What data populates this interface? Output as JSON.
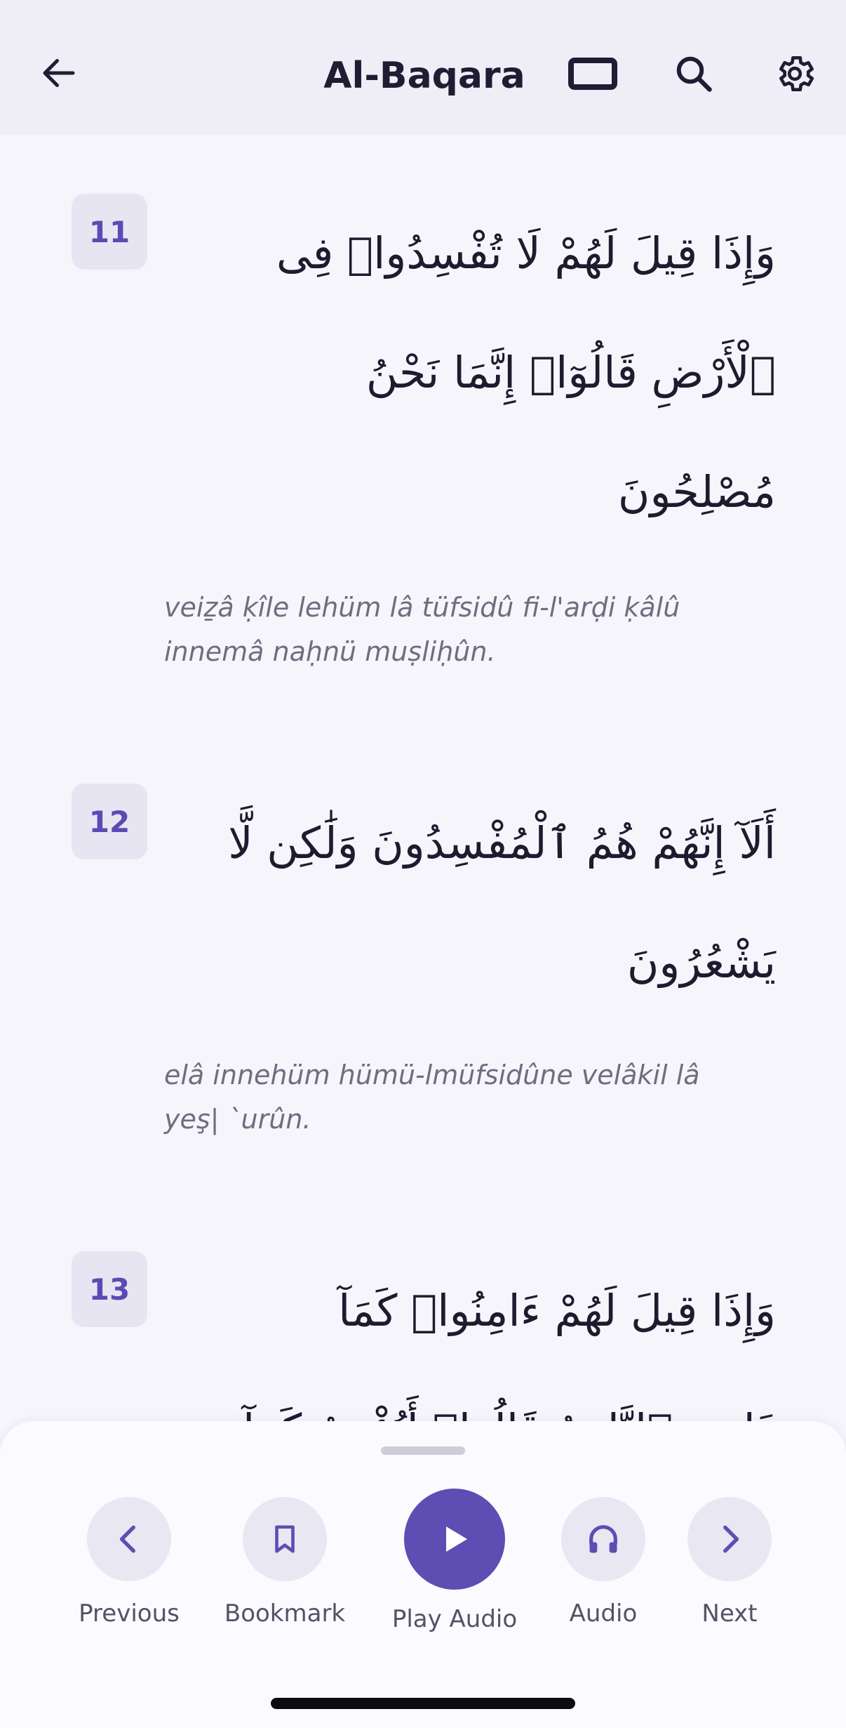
{
  "header": {
    "title": "Al-Baqara",
    "back_icon": "arrow-left-icon",
    "view_icon": "rectangle-view-icon",
    "search_icon": "search-icon",
    "settings_icon": "gear-icon"
  },
  "verses": [
    {
      "number": "11",
      "arabic_lines": [
        "وَإِذَا قِيلَ لَهُمْ لَا تُفْسِدُوا۟ فِى",
        "ٱلْأَرْضِ قَالُوٓا۟ إِنَّمَا نَحْنُ",
        "مُصْلِحُونَ"
      ],
      "transliteration_lines": [
        "veiẕâ ḳîle lehüm lâ tüfsidû fi-l'arḍi ḳâlû",
        "innemâ naḥnü muṣliḥûn."
      ]
    },
    {
      "number": "12",
      "arabic_lines": [
        "أَلَآ إِنَّهُمْ هُمُ ٱلْمُفْسِدُونَ وَلَٰكِن لَّا",
        "يَشْعُرُونَ"
      ],
      "transliteration_lines": [
        "elâ innehüm hümü-lmüfsidûne velâkil lâ",
        "yeş| `urûn."
      ]
    },
    {
      "number": "13",
      "arabic_lines": [
        "وَإِذَا قِيلَ لَهُمْ ءَامِنُوا۟ كَمَآ",
        "ءَامَنَ ٱلنَّاسُ قَالُوٓا۟ أَنُؤْمِنُ كَمَآ"
      ],
      "transliteration_lines": []
    }
  ],
  "player": {
    "previous_label": "Previous",
    "bookmark_label": "Bookmark",
    "play_label": "Play Audio",
    "audio_label": "Audio",
    "next_label": "Next",
    "icons": {
      "previous": "chevron-left-icon",
      "bookmark": "bookmark-icon",
      "play": "play-icon",
      "audio": "headphones-icon",
      "next": "chevron-right-icon"
    }
  },
  "colors": {
    "accent": "#5e4db2",
    "badge_bg": "#e7e5f2",
    "header_bg": "#efeef7",
    "page_bg": "#f6f5fb"
  }
}
